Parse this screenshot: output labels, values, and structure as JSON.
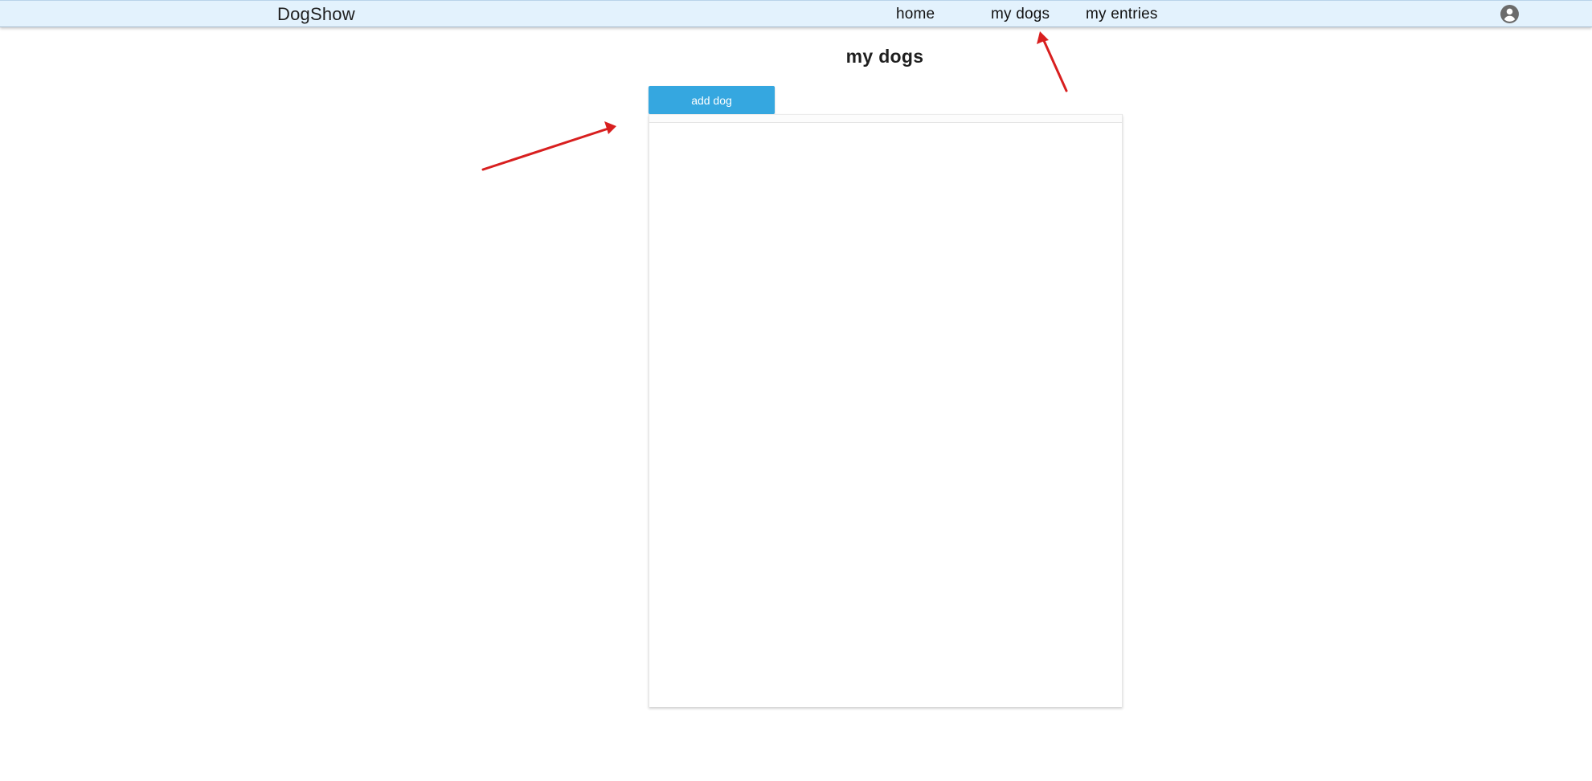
{
  "app": {
    "brand": "DogShow"
  },
  "nav": {
    "home": "home",
    "my_dogs": "my dogs",
    "my_entries": "my entries",
    "account_icon": "account-circle-icon"
  },
  "main": {
    "title": "my dogs",
    "add_button_label": "add dog",
    "dogs_list": []
  },
  "colors": {
    "topbar_background": "#e3f2fd",
    "primary_button": "#35a7e0",
    "annotation_arrow": "#d81f1f"
  }
}
